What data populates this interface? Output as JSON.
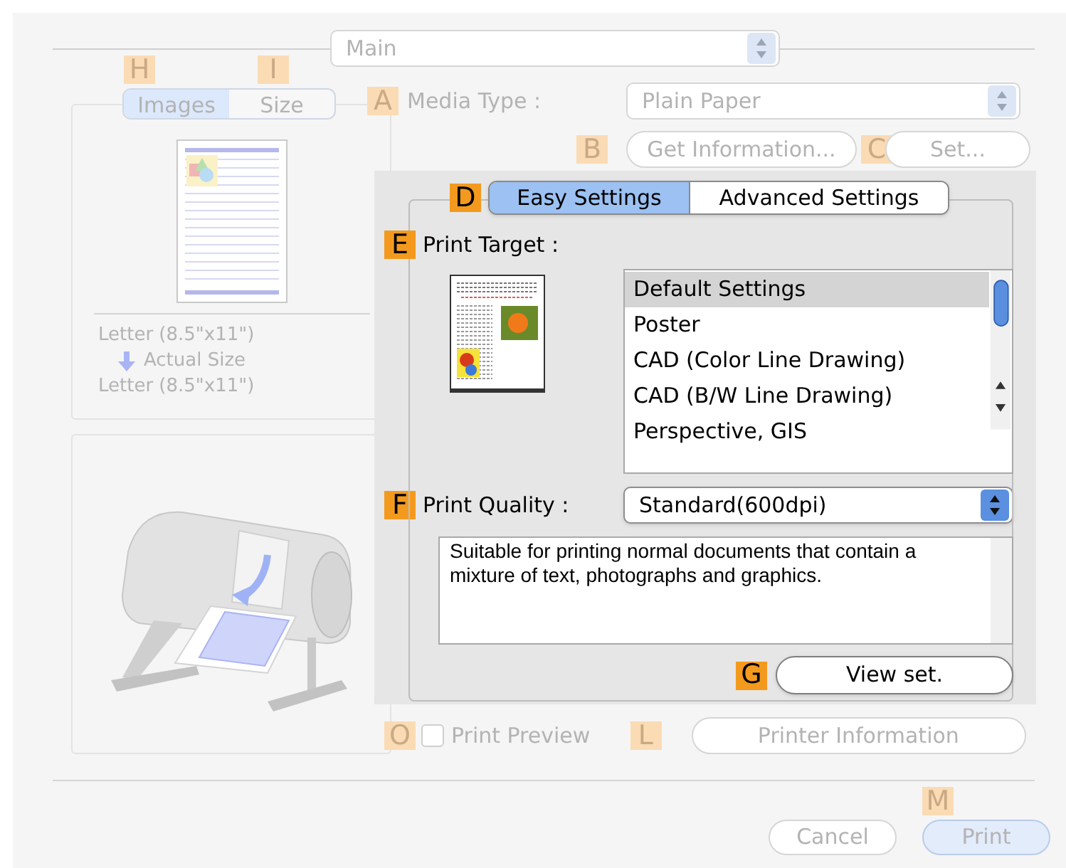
{
  "main_popup": {
    "value": "Main",
    "disabled": true
  },
  "preview_tabs": {
    "disabled": true,
    "callouts": [
      {
        "letter": "H",
        "dimmed": true
      },
      {
        "letter": "I",
        "dimmed": true
      }
    ],
    "tabs": [
      {
        "label": "Images",
        "selected": true
      },
      {
        "label": "Size",
        "selected": false
      }
    ]
  },
  "preview": {
    "lines": [
      "Letter (8.5\"x11\")",
      "Actual Size",
      "Letter (8.5\"x11\")"
    ]
  },
  "media_type": {
    "callout": {
      "letter": "A",
      "dimmed": true
    },
    "label": "Media Type :",
    "value": "Plain Paper",
    "disabled": true
  },
  "get_information": {
    "callout": {
      "letter": "B",
      "dimmed": true
    },
    "label": "Get Information...",
    "disabled": true
  },
  "set": {
    "callout": {
      "letter": "C",
      "dimmed": true
    },
    "label": "Set...",
    "disabled": true
  },
  "settings_tabs": {
    "callout": {
      "letter": "D",
      "dimmed": false
    },
    "tabs": [
      {
        "label": "Easy Settings",
        "selected": true
      },
      {
        "label": "Advanced Settings",
        "selected": false
      }
    ]
  },
  "print_target": {
    "callout": {
      "letter": "E",
      "dimmed": false
    },
    "label": "Print Target :",
    "items": [
      {
        "label": "Default Settings",
        "selected": true
      },
      {
        "label": "Poster",
        "selected": false
      },
      {
        "label": "CAD (Color Line Drawing)",
        "selected": false
      },
      {
        "label": "CAD (B/W Line Drawing)",
        "selected": false
      },
      {
        "label": "Perspective, GIS",
        "selected": false
      }
    ]
  },
  "print_quality": {
    "callout": {
      "letter": "F",
      "dimmed": false
    },
    "label": "Print Quality :",
    "value": "Standard(600dpi)",
    "description": "Suitable for printing normal documents that contain a mixture of text, photographs and graphics."
  },
  "view_settings": {
    "callout": {
      "letter": "G",
      "dimmed": false
    },
    "label": "View set.",
    "disabled": false
  },
  "print_preview": {
    "callout": {
      "letter": "O",
      "dimmed": true
    },
    "label": "Print Preview",
    "checked": false,
    "disabled": true
  },
  "printer_information": {
    "callout": {
      "letter": "L",
      "dimmed": true
    },
    "label": "Printer Information",
    "disabled": true
  },
  "buttons": [
    {
      "kind": "cancel",
      "label": "Cancel",
      "disabled": true
    },
    {
      "kind": "default",
      "label": "Print",
      "disabled": true,
      "callout": {
        "letter": "M",
        "dimmed": true
      }
    }
  ]
}
